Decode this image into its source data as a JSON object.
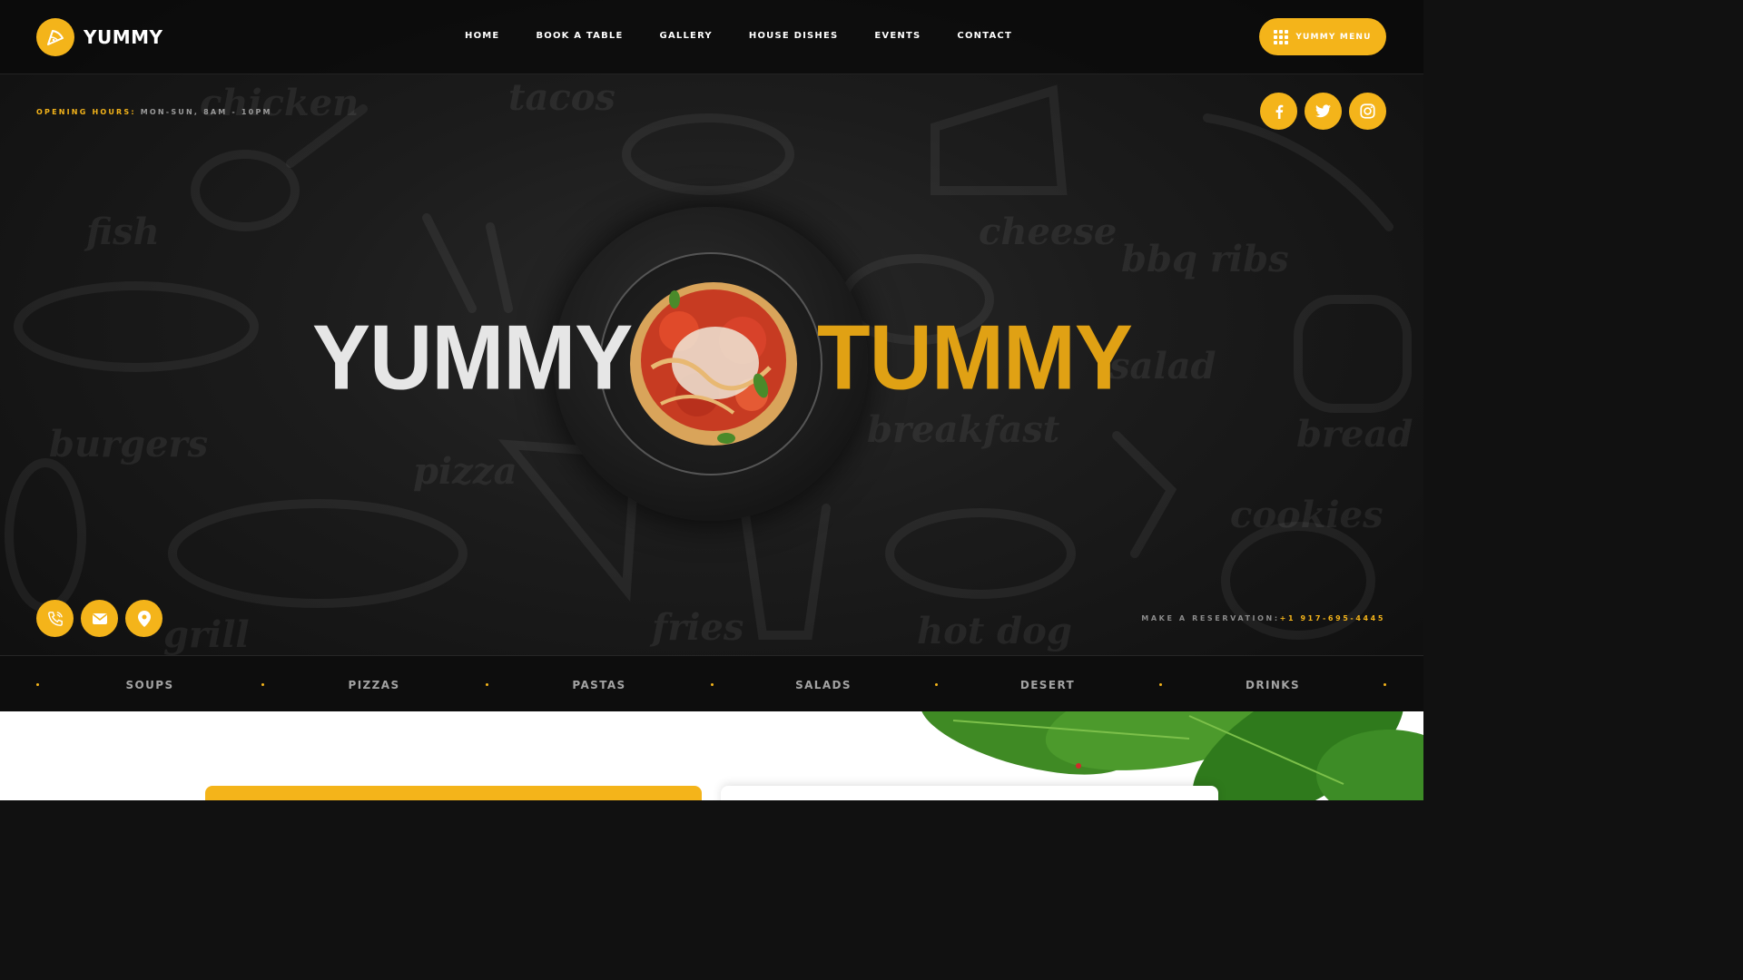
{
  "header": {
    "logo_text": "YUMMY",
    "nav": [
      "HOME",
      "BOOK A TABLE",
      "GALLERY",
      "HOUSE DISHES",
      "EVENTS",
      "CONTACT"
    ],
    "menu_button": "YUMMY MENU"
  },
  "info": {
    "hours_label": "OPENING HOURS:",
    "hours_value": " MON-SUN, 8AM - 10PM",
    "reservation_label": "MAKE A RESERVATION:",
    "reservation_value": "+1 917-695-4445"
  },
  "hero": {
    "word_left": "YUMMY",
    "word_right": "TUMMY"
  },
  "doodle_words": [
    "chicken",
    "tacos",
    "fish",
    "cheese",
    "bbq ribs",
    "salad",
    "breakfast",
    "bread",
    "burgers",
    "pizza",
    "cookies",
    "grill",
    "fries",
    "hot dog"
  ],
  "social_icons": [
    "facebook-icon",
    "twitter-icon",
    "instagram-icon"
  ],
  "contact_icons": [
    "phone-icon",
    "mail-icon",
    "location-icon"
  ],
  "categories": [
    "SOUPS",
    "PIZZAS",
    "PASTAS",
    "SALADS",
    "DESERT",
    "DRINKS"
  ],
  "colors": {
    "accent": "#f4b41a",
    "accent_dark": "#e0a114",
    "background": "#1a1a1a",
    "light_text": "#e6e6e6"
  }
}
